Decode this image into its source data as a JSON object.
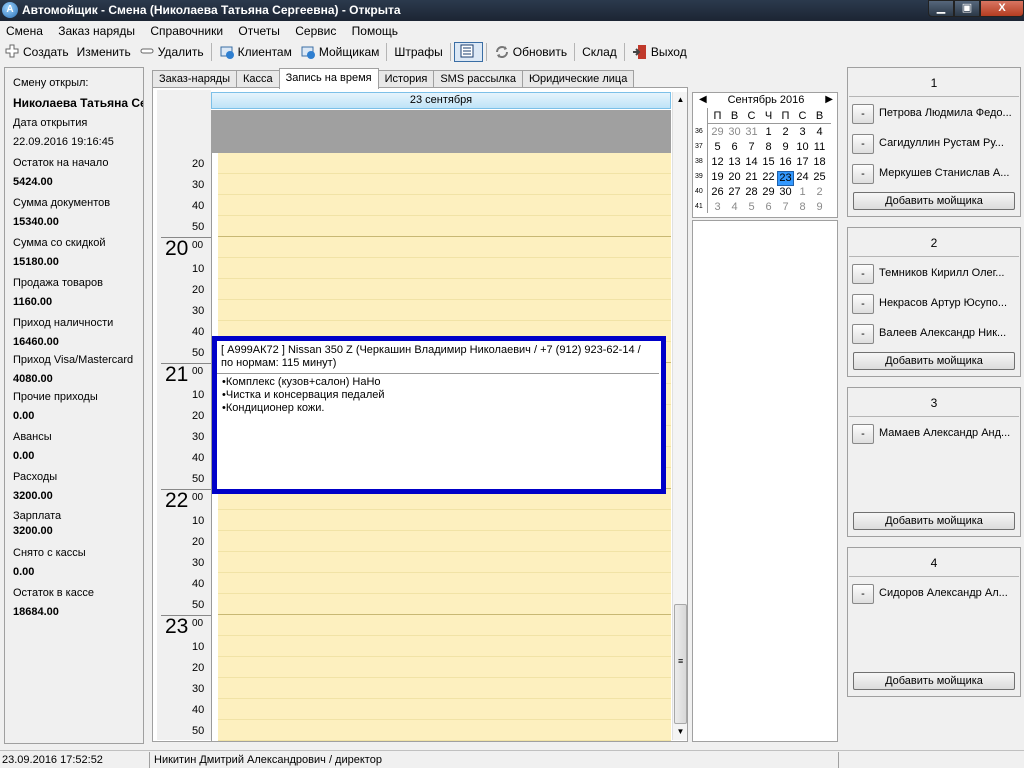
{
  "window": {
    "title": "Автомойщик - Смена (Николаева Татьяна Сергеевна) - Открыта",
    "icon_letter": "A",
    "controls": {
      "minimize": "▁",
      "maximize": "▣",
      "close": "X"
    }
  },
  "menu": [
    "Смена",
    "Заказ наряды",
    "Справочники",
    "Отчеты",
    "Сервис",
    "Помощь"
  ],
  "toolbar": {
    "create": "Создать",
    "edit": "Изменить",
    "delete": "Удалить",
    "clients": "Клиентам",
    "washers": "Мойщикам",
    "fines": "Штрафы",
    "refresh": "Обновить",
    "warehouse": "Склад",
    "exit": "Выход"
  },
  "shift": [
    {
      "label": "Смену открыл:",
      "value": "Николаева Татьяна Се"
    },
    {
      "label": "Дата открытия",
      "value": "22.09.2016 19:16:45"
    },
    {
      "label": "Остаток на начало",
      "value": "5424.00"
    },
    {
      "label": "Сумма документов",
      "value": "15340.00"
    },
    {
      "label": "Сумма со скидкой",
      "value": "15180.00"
    },
    {
      "label": "Продажа товаров",
      "value": "1160.00"
    },
    {
      "label": "Приход наличности",
      "value": "16460.00"
    },
    {
      "label": "Приход Visa/Mastercard",
      "value": "4080.00"
    },
    {
      "label": "Прочие приходы",
      "value": "0.00"
    },
    {
      "label": "Авансы",
      "value": "0.00"
    },
    {
      "label": "Расходы",
      "value": "3200.00"
    },
    {
      "label": "Зарплата",
      "value": "3200.00"
    },
    {
      "label": "Снято с кассы",
      "value": "0.00"
    },
    {
      "label": "Остаток в кассе",
      "value": "18684.00"
    }
  ],
  "tabs": [
    "Заказ-наряды",
    "Касса",
    "Запись на время",
    "История",
    "SMS рассылка",
    "Юридические лица"
  ],
  "active_tab": 2,
  "scheduler": {
    "day_header": "23 сентября",
    "slots": [
      {
        "hour": "",
        "minute": "20"
      },
      {
        "hour": "",
        "minute": "30"
      },
      {
        "hour": "",
        "minute": "40"
      },
      {
        "hour": "",
        "minute": "50"
      },
      {
        "hour": "20",
        "minute": "00"
      },
      {
        "hour": "",
        "minute": "10"
      },
      {
        "hour": "",
        "minute": "20"
      },
      {
        "hour": "",
        "minute": "30"
      },
      {
        "hour": "",
        "minute": "40"
      },
      {
        "hour": "",
        "minute": "50"
      },
      {
        "hour": "21",
        "minute": "00"
      },
      {
        "hour": "",
        "minute": "10"
      },
      {
        "hour": "",
        "minute": "20"
      },
      {
        "hour": "",
        "minute": "30"
      },
      {
        "hour": "",
        "minute": "40"
      },
      {
        "hour": "",
        "minute": "50"
      },
      {
        "hour": "22",
        "minute": "00"
      },
      {
        "hour": "",
        "minute": "10"
      },
      {
        "hour": "",
        "minute": "20"
      },
      {
        "hour": "",
        "minute": "30"
      },
      {
        "hour": "",
        "minute": "40"
      },
      {
        "hour": "",
        "minute": "50"
      },
      {
        "hour": "23",
        "minute": "00"
      },
      {
        "hour": "",
        "minute": "10"
      },
      {
        "hour": "",
        "minute": "20"
      },
      {
        "hour": "",
        "minute": "30"
      },
      {
        "hour": "",
        "minute": "40"
      },
      {
        "hour": "",
        "minute": "50"
      }
    ],
    "appointment": {
      "header": "[ А999АК72 ] Nissan 350 Z (Черкашин Владимир Николаевич / +7 (912) 923-62-14 / по нормам: 115 минут)",
      "services": [
        "Комплекс (кузов+салон) НаНо",
        "Чистка и консервация педалей",
        "Кондиционер кожи."
      ],
      "border_color": "#0000c8"
    }
  },
  "calendar": {
    "month_title": "Сентябрь 2016",
    "prev": "◀",
    "next": "▶",
    "weekdays": [
      "П",
      "В",
      "С",
      "Ч",
      "П",
      "С",
      "В"
    ],
    "weeks": [
      {
        "num": "36",
        "days": [
          {
            "d": "29",
            "o": true
          },
          {
            "d": "30",
            "o": true
          },
          {
            "d": "31",
            "o": true
          },
          {
            "d": "1"
          },
          {
            "d": "2"
          },
          {
            "d": "3"
          },
          {
            "d": "4"
          }
        ]
      },
      {
        "num": "37",
        "days": [
          {
            "d": "5"
          },
          {
            "d": "6"
          },
          {
            "d": "7"
          },
          {
            "d": "8"
          },
          {
            "d": "9"
          },
          {
            "d": "10"
          },
          {
            "d": "11"
          }
        ]
      },
      {
        "num": "38",
        "days": [
          {
            "d": "12"
          },
          {
            "d": "13"
          },
          {
            "d": "14"
          },
          {
            "d": "15"
          },
          {
            "d": "16"
          },
          {
            "d": "17"
          },
          {
            "d": "18"
          }
        ]
      },
      {
        "num": "39",
        "days": [
          {
            "d": "19"
          },
          {
            "d": "20"
          },
          {
            "d": "21"
          },
          {
            "d": "22"
          },
          {
            "d": "23",
            "t": true
          },
          {
            "d": "24"
          },
          {
            "d": "25"
          }
        ]
      },
      {
        "num": "40",
        "days": [
          {
            "d": "26"
          },
          {
            "d": "27"
          },
          {
            "d": "28"
          },
          {
            "d": "29"
          },
          {
            "d": "30"
          },
          {
            "d": "1",
            "o": true
          },
          {
            "d": "2",
            "o": true
          }
        ]
      },
      {
        "num": "41",
        "days": [
          {
            "d": "3",
            "o": true
          },
          {
            "d": "4",
            "o": true
          },
          {
            "d": "5",
            "o": true
          },
          {
            "d": "6",
            "o": true
          },
          {
            "d": "7",
            "o": true
          },
          {
            "d": "8",
            "o": true
          },
          {
            "d": "9",
            "o": true
          }
        ]
      }
    ]
  },
  "boxes": [
    {
      "number": "1",
      "workers": [
        "Петрова Людмила Федо...",
        "Сагидуллин Рустам Ру...",
        "Меркушев Станислав А..."
      ]
    },
    {
      "number": "2",
      "workers": [
        "Темников Кирилл Олег...",
        "Некрасов Артур Юсупо...",
        "Валеев Александр Ник..."
      ]
    },
    {
      "number": "3",
      "workers": [
        "Мамаев Александр Анд..."
      ]
    },
    {
      "number": "4",
      "workers": [
        "Сидоров Александр Ал..."
      ]
    }
  ],
  "box_add_label": "Добавить мойщика",
  "box_remove_label": "-",
  "status": {
    "datetime": "23.09.2016 17:52:52",
    "user": "Никитин Дмитрий Александрович / директор"
  },
  "colors": {
    "slot_bg": "#fdf0bf",
    "today_bg": "#3399ff",
    "header_bg": "#bfe3f7"
  }
}
